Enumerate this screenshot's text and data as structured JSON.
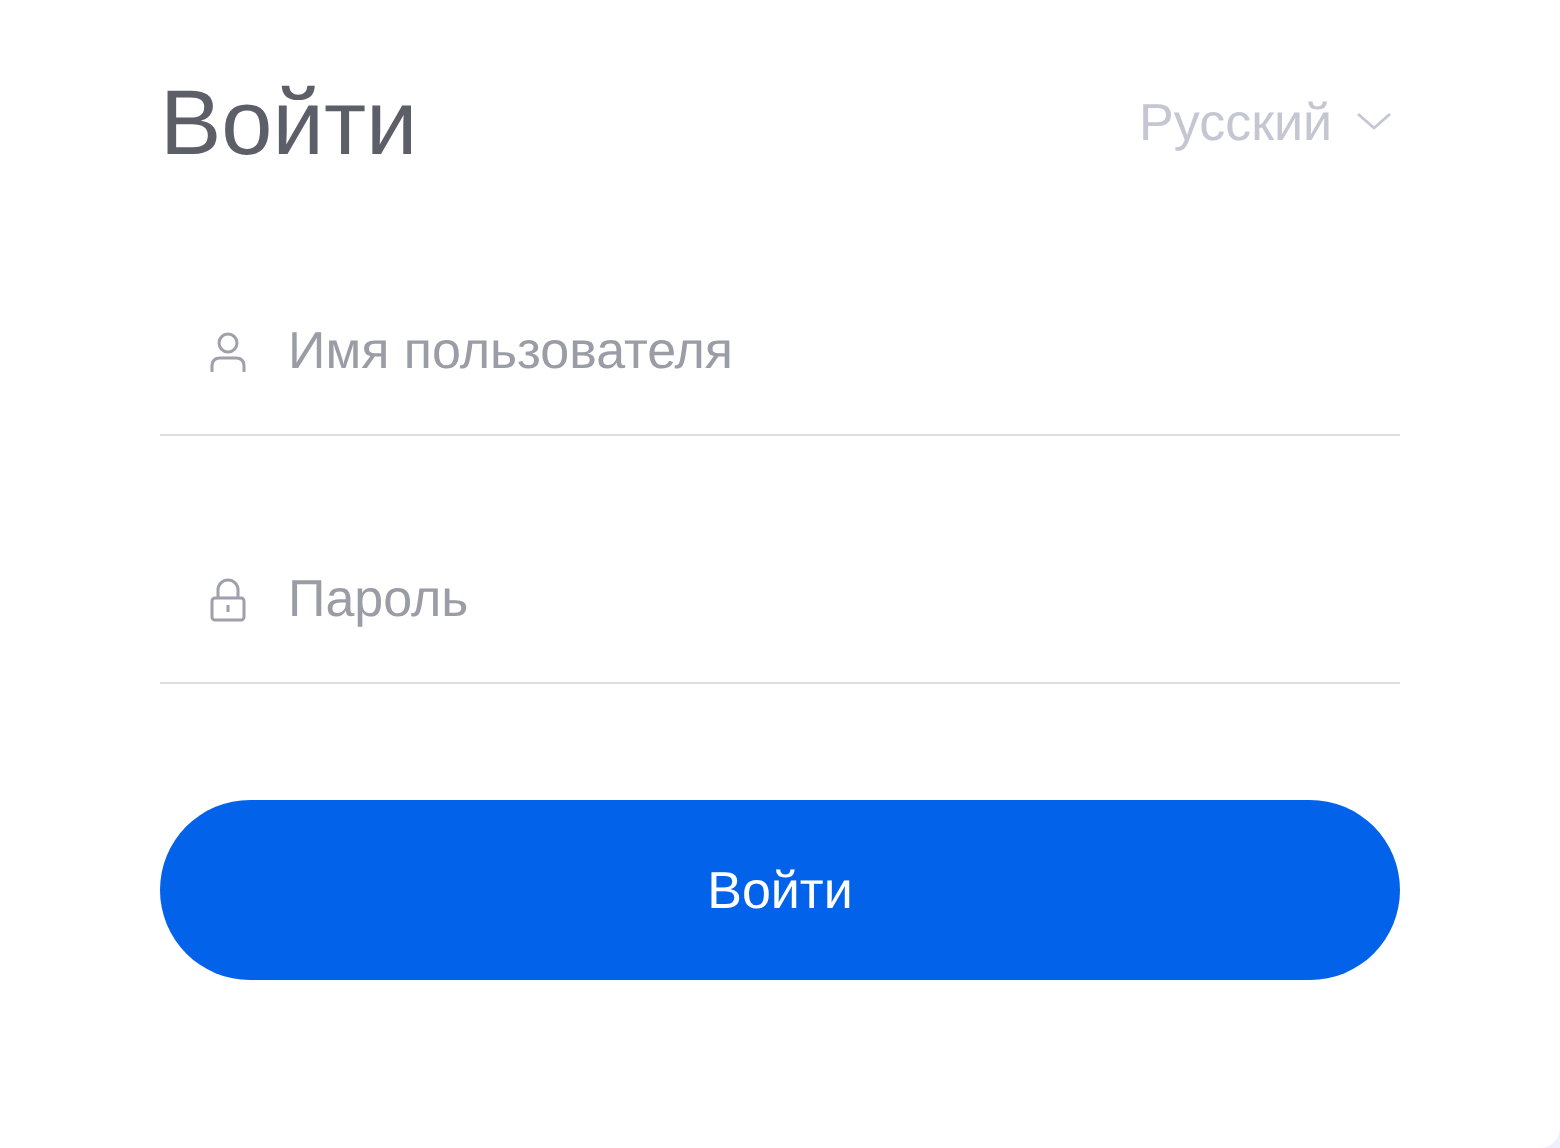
{
  "title": "Войти",
  "language": {
    "label": "Русский"
  },
  "fields": [
    {
      "kind": "user",
      "placeholder": "Имя пользователя"
    },
    {
      "kind": "password",
      "placeholder": "Пароль"
    }
  ],
  "submit": {
    "label": "Войти"
  }
}
